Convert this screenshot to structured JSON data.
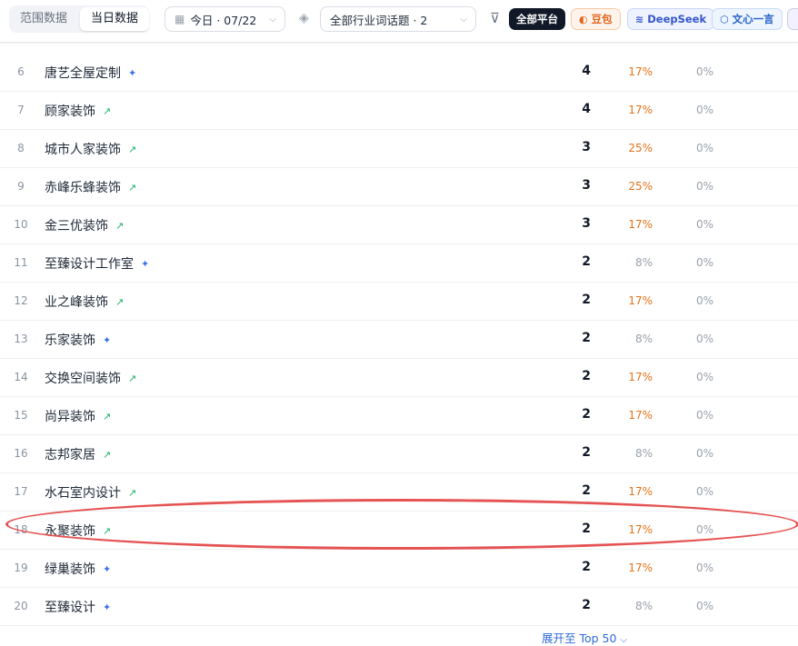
{
  "toolbar": {
    "tab_range": "范围数据",
    "tab_today": "当日数据",
    "date_label": "今日 · 07/22",
    "industry_label": "全部行业词话题 · 2",
    "platforms": {
      "all": "全部平台",
      "doubao": "豆包",
      "deepseek": "DeepSeek",
      "wenxin": "文心一言"
    }
  },
  "rows": [
    {
      "rank": "6",
      "name": "唐艺全屋定制",
      "trend": "new",
      "count": "4",
      "pct": "17%",
      "zero": "0%"
    },
    {
      "rank": "7",
      "name": "顾家装饰",
      "trend": "up",
      "count": "4",
      "pct": "17%",
      "zero": "0%"
    },
    {
      "rank": "8",
      "name": "城市人家装饰",
      "trend": "up",
      "count": "3",
      "pct": "25%",
      "zero": "0%"
    },
    {
      "rank": "9",
      "name": "赤峰乐蜂装饰",
      "trend": "up",
      "count": "3",
      "pct": "25%",
      "zero": "0%"
    },
    {
      "rank": "10",
      "name": "金三优装饰",
      "trend": "up",
      "count": "3",
      "pct": "17%",
      "zero": "0%"
    },
    {
      "rank": "11",
      "name": "至臻设计工作室",
      "trend": "new",
      "count": "2",
      "pct": "8%",
      "zero": "0%"
    },
    {
      "rank": "12",
      "name": "业之峰装饰",
      "trend": "up",
      "count": "2",
      "pct": "17%",
      "zero": "0%"
    },
    {
      "rank": "13",
      "name": "乐家装饰",
      "trend": "new",
      "count": "2",
      "pct": "8%",
      "zero": "0%"
    },
    {
      "rank": "14",
      "name": "交换空间装饰",
      "trend": "up",
      "count": "2",
      "pct": "17%",
      "zero": "0%"
    },
    {
      "rank": "15",
      "name": "尚异装饰",
      "trend": "up",
      "count": "2",
      "pct": "17%",
      "zero": "0%"
    },
    {
      "rank": "16",
      "name": "志邦家居",
      "trend": "up",
      "count": "2",
      "pct": "8%",
      "zero": "0%"
    },
    {
      "rank": "17",
      "name": "水石室内设计",
      "trend": "up",
      "count": "2",
      "pct": "17%",
      "zero": "0%"
    },
    {
      "rank": "18",
      "name": "永聚装饰",
      "trend": "up",
      "count": "2",
      "pct": "17%",
      "zero": "0%"
    },
    {
      "rank": "19",
      "name": "绿巢装饰",
      "trend": "new",
      "count": "2",
      "pct": "17%",
      "zero": "0%"
    },
    {
      "rank": "20",
      "name": "至臻设计",
      "trend": "new",
      "count": "2",
      "pct": "8%",
      "zero": "0%"
    }
  ],
  "expand_label": "展开至 Top 50",
  "colors": {
    "accent": "#2f6bd8",
    "trend_up": "#20b26b",
    "trend_new": "#3b72e8",
    "pct_warm": "#e2731a",
    "highlight": "#e55353"
  }
}
